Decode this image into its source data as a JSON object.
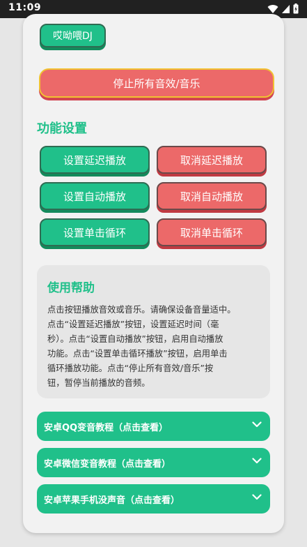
{
  "status_bar": {
    "time": "11:09"
  },
  "top_button": {
    "label": "哎呦喂DJ"
  },
  "stop_button": {
    "label": "停止所有音效/音乐"
  },
  "settings": {
    "title": "功能设置",
    "set_delay": "设置延迟播放",
    "cancel_delay": "取消延迟播放",
    "set_auto": "设置自动播放",
    "cancel_auto": "取消自动播放",
    "set_loop": "设置单击循环",
    "cancel_loop": "取消单击循环"
  },
  "help": {
    "title": "使用帮助",
    "lines": [
      "点击按钮播放音效或音乐。请确保设备音量适中。",
      "点击“设置延迟播放”按钮，设置延迟时间（毫",
      "秒）。点击“设置自动播放”按钮，启用自动播放",
      "功能。点击“设置单击循环播放”按钮，启用单击",
      "循环播放功能。点击“停止所有音效/音乐”按",
      "钮，暂停当前播放的音频。"
    ]
  },
  "accordions": [
    {
      "label": "安卓QQ变音教程（点击查看）"
    },
    {
      "label": "安卓微信变音教程（点击查看）"
    },
    {
      "label": "安卓苹果手机没声音（点击查看）"
    }
  ],
  "colors": {
    "green": "#20c08a",
    "red": "#ec6969",
    "status_bar": "#212121"
  },
  "icons": [
    "wifi-icon",
    "cellular-signal-icon",
    "battery-icon",
    "chevron-down-icon"
  ]
}
